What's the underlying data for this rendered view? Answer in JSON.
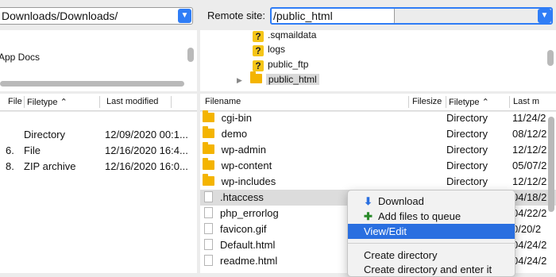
{
  "local": {
    "site_path": "Downloads/Downloads/",
    "tree_items": [
      "App Docs"
    ],
    "columns": {
      "size": "File",
      "type": "Filetype",
      "modified": "Last modified"
    },
    "rows": [
      {
        "size": "",
        "type": "Directory",
        "modified": "12/09/2020 00:1..."
      },
      {
        "size": "6.",
        "type": "File",
        "modified": "12/16/2020 16:4..."
      },
      {
        "size": "8.",
        "type": "ZIP archive",
        "modified": "12/16/2020 16:0..."
      }
    ]
  },
  "remote": {
    "label": "Remote site:",
    "site_path": "/public_html",
    "tree_items": [
      {
        "icon": "question-icon",
        "name": ".sqmaildata"
      },
      {
        "icon": "question-icon",
        "name": "logs"
      },
      {
        "icon": "question-icon",
        "name": "public_ftp"
      },
      {
        "icon": "folder-icon",
        "name": "public_html"
      }
    ],
    "columns": {
      "name": "Filename",
      "size": "Filesize",
      "type": "Filetype",
      "modified": "Last m"
    },
    "rows": [
      {
        "icon": "folder-icon",
        "name": "cgi-bin",
        "type": "Directory",
        "modified": "11/24/2"
      },
      {
        "icon": "folder-icon",
        "name": "demo",
        "type": "Directory",
        "modified": "08/12/2"
      },
      {
        "icon": "folder-icon",
        "name": "wp-admin",
        "type": "Directory",
        "modified": "12/12/2"
      },
      {
        "icon": "folder-icon",
        "name": "wp-content",
        "type": "Directory",
        "modified": "05/07/2"
      },
      {
        "icon": "folder-icon",
        "name": "wp-includes",
        "type": "Directory",
        "modified": "12/12/2"
      },
      {
        "icon": "file-icon",
        "name": ".htaccess",
        "type": "",
        "modified": "04/18/2"
      },
      {
        "icon": "file-icon",
        "name": "php_errorlog",
        "type": "",
        "modified": "04/22/2"
      },
      {
        "icon": "file-icon",
        "name": "favicon.gif",
        "type": "",
        "modified": "0/20/2"
      },
      {
        "icon": "file-icon",
        "name": "Default.html",
        "type": "",
        "modified": "04/24/2"
      },
      {
        "icon": "file-icon",
        "name": "readme.html",
        "type": "",
        "modified": "04/24/2"
      }
    ]
  },
  "context_menu": {
    "items": [
      {
        "icon": "download-arrow-icon",
        "label": "Download"
      },
      {
        "icon": "add-to-queue-icon",
        "label": "Add files to queue"
      },
      {
        "icon": "",
        "label": "View/Edit"
      },
      {
        "icon": "",
        "label": "Create directory"
      },
      {
        "icon": "",
        "label": "Create directory and enter it"
      }
    ],
    "highlighted": "View/Edit"
  },
  "colors": {
    "accent": "#2a6fe0",
    "folder": "#f4b400",
    "question": "#f5c518"
  }
}
